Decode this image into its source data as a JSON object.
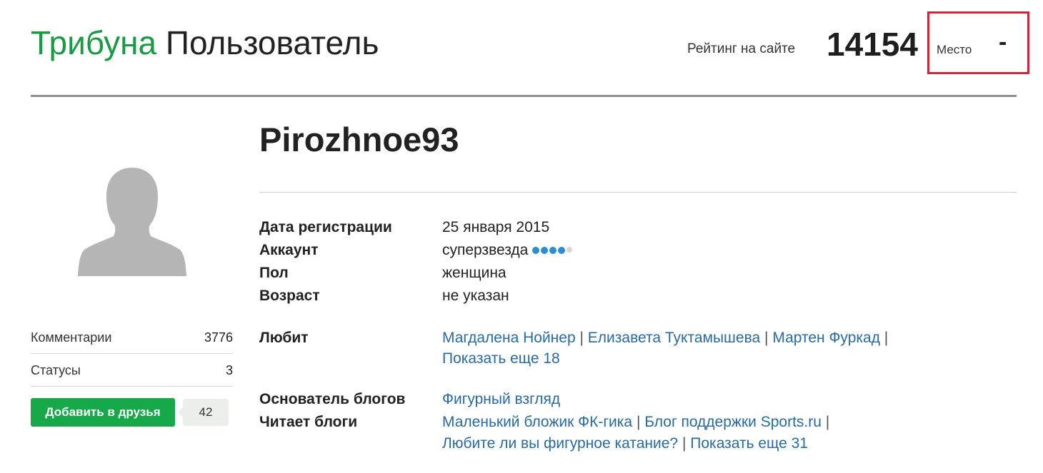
{
  "header": {
    "brand": "Трибуна",
    "section": "Пользователь",
    "rating_label": "Рейтинг на сайте",
    "rating_value": "14154",
    "place_label": "Место",
    "place_value": "-",
    "highlight_color": "#c8283a",
    "brand_color": "#1a9a45"
  },
  "profile": {
    "username": "Pirozhnoe93",
    "avatar_icon": "user-silhouette-icon"
  },
  "sidebar": {
    "stats": [
      {
        "label": "Комментарии",
        "value": "3776"
      },
      {
        "label": "Статусы",
        "value": "3"
      }
    ],
    "add_friend_label": "Добавить в друзья",
    "friends_count": "42"
  },
  "info": {
    "registration_label": "Дата регистрации",
    "registration_value": "25 января 2015",
    "account_label": "Аккаунт",
    "account_value": "суперзвезда",
    "account_level": {
      "filled": 4,
      "total": 5,
      "filled_color": "#2a8fd0",
      "empty_color": "#d6d6d6"
    },
    "gender_label": "Пол",
    "gender_value": "женщина",
    "age_label": "Возраст",
    "age_value": "не указан",
    "likes_label": "Любит",
    "likes": [
      "Магдалена Нойнер",
      "Елизавета Туктамышева",
      "Мартен Фуркад"
    ],
    "likes_more": "Показать еще 18",
    "founder_label": "Основатель блогов",
    "founder_blog": "Фигурный взгляд",
    "reads_label": "Читает блоги",
    "reads": [
      "Маленький бложик ФК-гика",
      "Блог поддержки Sports.ru",
      "Любите ли вы фигурное катание?"
    ],
    "reads_more": "Показать еще 31"
  }
}
